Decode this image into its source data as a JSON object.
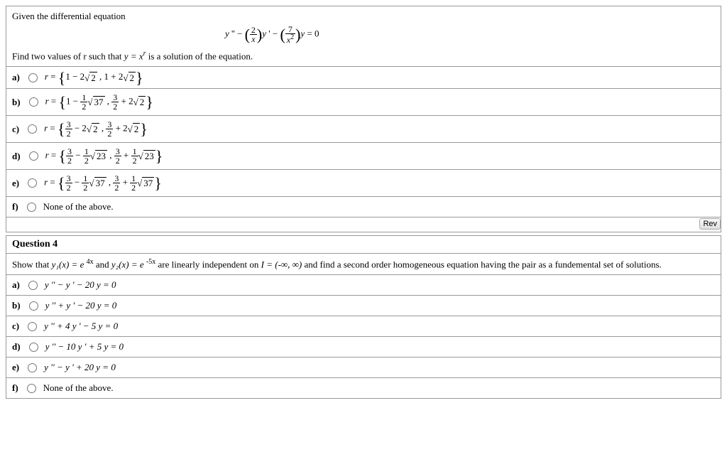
{
  "q3": {
    "prompt_line1": "Given the differential equation",
    "equation_plain": "y '' − (2/x) y ' − (7/x²) y = 0",
    "prompt_line2_prefix": "Find two values of r such that ",
    "prompt_line2_mid": "y = x",
    "prompt_line2_exp": "r",
    "prompt_line2_suffix": " is a solution of the equation.",
    "options": {
      "a_label": "a)",
      "a_text": "r = { 1 − 2√2 , 1 + 2√2 }",
      "b_label": "b)",
      "b_text": "r = { 1 − (1/2)√37 , 3/2 + 2√2 }",
      "c_label": "c)",
      "c_text": "r = { 3/2 − 2√2 , 3/2 + 2√2 }",
      "d_label": "d)",
      "d_text": "r = { 3/2 − (1/2)√23 , 3/2 + (1/2)√23 }",
      "e_label": "e)",
      "e_text": "r = { 3/2 − (1/2)√37 , 3/2 + (1/2)√37 }",
      "f_label": "f)",
      "f_text": "None of the above."
    },
    "review_btn": "Rev"
  },
  "q4": {
    "header": "Question 4",
    "prompt_prefix": "Show that ",
    "y1": "y₁(x) = e ",
    "exp1": "4x",
    "and": " and ",
    "y2": "y₂(x) = e ",
    "exp2": "-5x",
    "prompt_mid": " are linearly independent on ",
    "interval": "I = (-∞, ∞)",
    "prompt_suffix": " and find a second order homogeneous equation having the pair as a fundemental set of solutions.",
    "options": {
      "a_label": "a)",
      "a_text": "y '' − y ' − 20 y = 0",
      "b_label": "b)",
      "b_text": "y '' + y ' − 20 y = 0",
      "c_label": "c)",
      "c_text": "y '' + 4 y ' − 5 y = 0",
      "d_label": "d)",
      "d_text": "y '' − 10 y ' + 5 y = 0",
      "e_label": "e)",
      "e_text": "y '' − y ' + 20 y = 0",
      "f_label": "f)",
      "f_text": "None of the above."
    }
  }
}
